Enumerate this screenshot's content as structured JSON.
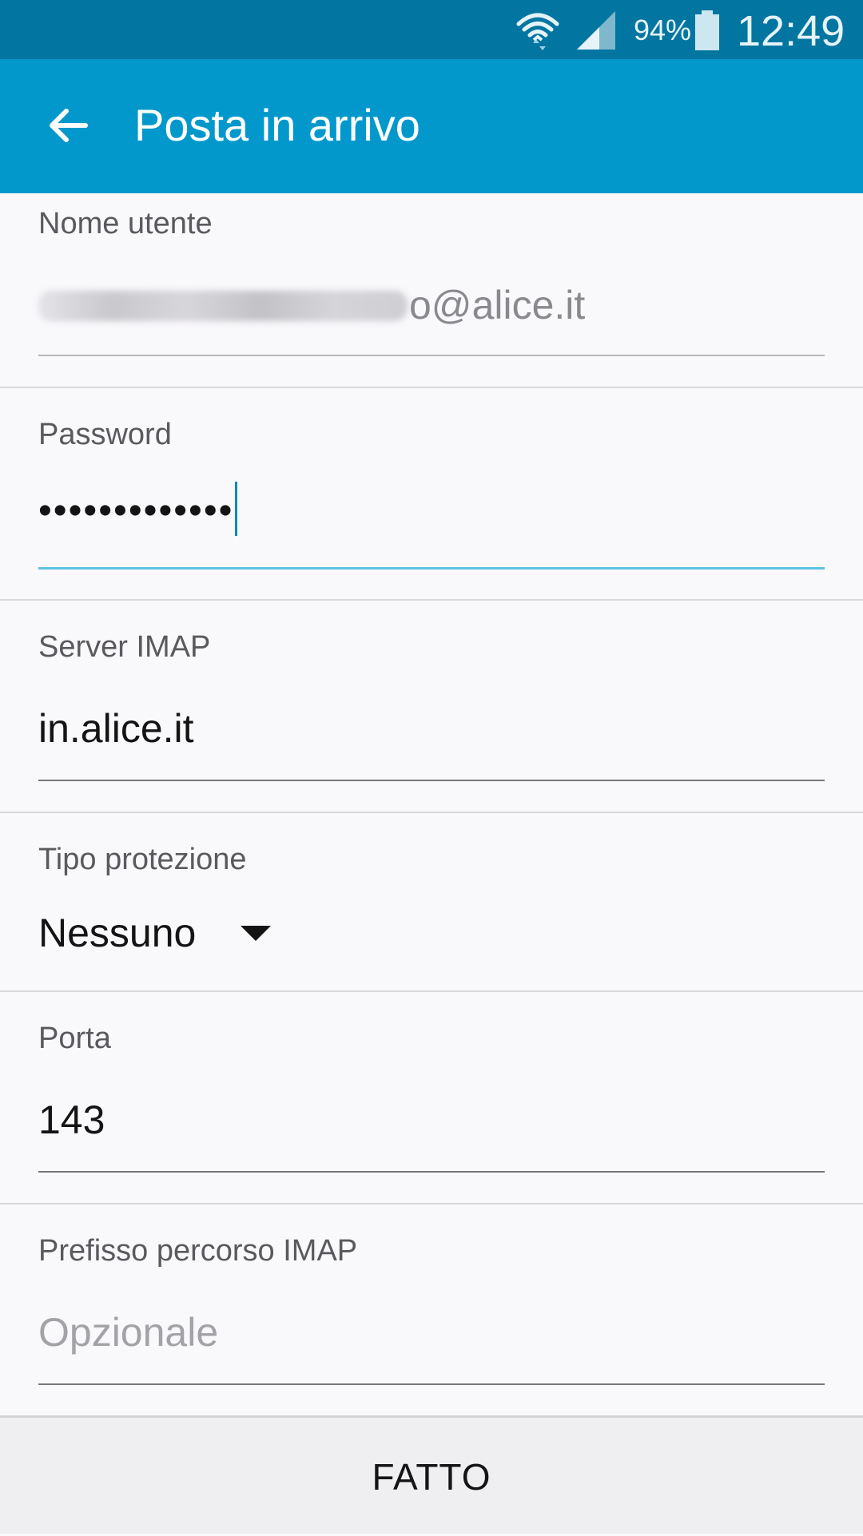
{
  "status_bar": {
    "battery_percent": "94%",
    "time": "12:49"
  },
  "app_bar": {
    "title": "Posta in arrivo"
  },
  "form": {
    "username": {
      "label": "Nome utente",
      "value_visible_suffix": "o@alice.it"
    },
    "password": {
      "label": "Password",
      "value_masked": "•••••••••••••"
    },
    "imap_server": {
      "label": "Server IMAP",
      "value": "in.alice.it"
    },
    "security_type": {
      "label": "Tipo protezione",
      "selected": "Nessuno"
    },
    "port": {
      "label": "Porta",
      "value": "143"
    },
    "imap_path_prefix": {
      "label": "Prefisso percorso IMAP",
      "placeholder": "Opzionale"
    }
  },
  "bottom_bar": {
    "done_label": "FATTO"
  },
  "colors": {
    "status_bar": "#0276a1",
    "app_bar": "#0298cc",
    "focus_underline": "#5ec3df",
    "background": "#f9f8fb"
  }
}
